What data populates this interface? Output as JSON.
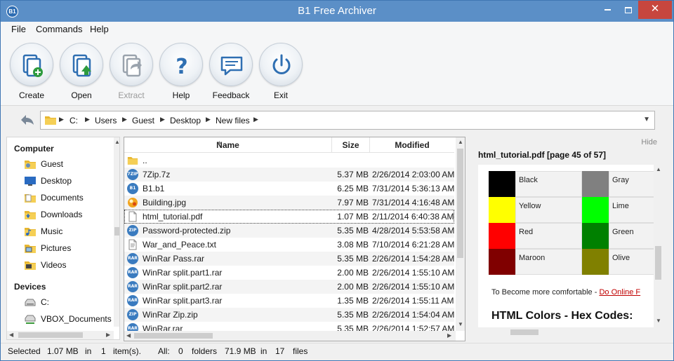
{
  "window": {
    "title": "B1 Free Archiver",
    "app_icon_text": "B1"
  },
  "menu": {
    "items": [
      "File",
      "Commands",
      "Help"
    ]
  },
  "toolbar": {
    "buttons": [
      {
        "label": "Create",
        "icon": "create-archive-icon",
        "enabled": true
      },
      {
        "label": "Open",
        "icon": "open-archive-icon",
        "enabled": true
      },
      {
        "label": "Extract",
        "icon": "extract-icon",
        "enabled": false
      },
      {
        "label": "Help",
        "icon": "help-icon",
        "enabled": true
      },
      {
        "label": "Feedback",
        "icon": "feedback-icon",
        "enabled": true
      },
      {
        "label": "Exit",
        "icon": "power-icon",
        "enabled": true
      }
    ]
  },
  "address": {
    "crumbs": [
      "C:",
      "Users",
      "Guest",
      "Desktop",
      "New files"
    ]
  },
  "sidebar": {
    "computer_header": "Computer",
    "computer_items": [
      "Guest",
      "Desktop",
      "Documents",
      "Downloads",
      "Music",
      "Pictures",
      "Videos"
    ],
    "devices_header": "Devices",
    "device_items": [
      "C:",
      "VBOX_Documents (E"
    ]
  },
  "files": {
    "columns": {
      "name": "Name",
      "size": "Size",
      "modified": "Modified"
    },
    "rows": [
      {
        "name": "..",
        "size": "",
        "modified": "",
        "icon": "folder"
      },
      {
        "name": "7Zip.7z",
        "size": "5.37 MB",
        "modified": "2/26/2014 2:03:00 AM",
        "icon": "7zip",
        "badge": "7ZIP"
      },
      {
        "name": "B1.b1",
        "size": "6.25 MB",
        "modified": "7/31/2014 5:36:13 AM",
        "icon": "b1",
        "badge": "B1"
      },
      {
        "name": "Building.jpg",
        "size": "7.97 MB",
        "modified": "7/31/2014 4:16:48 AM",
        "icon": "image"
      },
      {
        "name": "html_tutorial.pdf",
        "size": "1.07 MB",
        "modified": "2/11/2014 6:40:38 AM",
        "icon": "pdf",
        "selected": true
      },
      {
        "name": "Password-protected.zip",
        "size": "5.35 MB",
        "modified": "4/28/2014 5:53:58 AM",
        "icon": "zip",
        "badge": "ZIP"
      },
      {
        "name": "War_and_Peace.txt",
        "size": "3.08 MB",
        "modified": "7/10/2014 6:21:28 AM",
        "icon": "txt"
      },
      {
        "name": "WinRar Pass.rar",
        "size": "5.35 MB",
        "modified": "2/26/2014 1:54:28 AM",
        "icon": "rar",
        "badge": "RAR"
      },
      {
        "name": "WinRar split.part1.rar",
        "size": "2.00 MB",
        "modified": "2/26/2014 1:55:10 AM",
        "icon": "rar",
        "badge": "RAR"
      },
      {
        "name": "WinRar split.part2.rar",
        "size": "2.00 MB",
        "modified": "2/26/2014 1:55:10 AM",
        "icon": "rar",
        "badge": "RAR"
      },
      {
        "name": "WinRar split.part3.rar",
        "size": "1.35 MB",
        "modified": "2/26/2014 1:55:11 AM",
        "icon": "rar",
        "badge": "RAR"
      },
      {
        "name": "WinRar Zip.zip",
        "size": "5.35 MB",
        "modified": "2/26/2014 1:54:04 AM",
        "icon": "zip",
        "badge": "ZIP"
      },
      {
        "name": "WinRar.rar",
        "size": "5.35 MB",
        "modified": "2/26/2014 1:52:57 AM",
        "icon": "rar",
        "badge": "RAR"
      }
    ]
  },
  "preview": {
    "hide_label": "Hide",
    "title": "html_tutorial.pdf  [page 45 of 57]",
    "colors": [
      {
        "name": "Black",
        "hex": "#000000"
      },
      {
        "name": "Gray",
        "hex": "#808080"
      },
      {
        "name": "Yellow",
        "hex": "#FFFF00"
      },
      {
        "name": "Lime",
        "hex": "#00FF00"
      },
      {
        "name": "Red",
        "hex": "#FF0000"
      },
      {
        "name": "Green",
        "hex": "#008000"
      },
      {
        "name": "Maroon",
        "hex": "#800000"
      },
      {
        "name": "Olive",
        "hex": "#808000"
      }
    ],
    "body_text": "To Become more comfortable - ",
    "body_link": "Do Online F",
    "heading": "HTML Colors - Hex Codes:"
  },
  "status": {
    "selected_label": "Selected",
    "selected_size": "1.07 MB",
    "in1": "in",
    "selected_count": "1",
    "items_label": "item(s).",
    "all_label": "All:",
    "folders_count": "0",
    "folders_label": "folders",
    "total_size": "71.9 MB",
    "in2": "in",
    "files_count": "17",
    "files_label": "files"
  }
}
